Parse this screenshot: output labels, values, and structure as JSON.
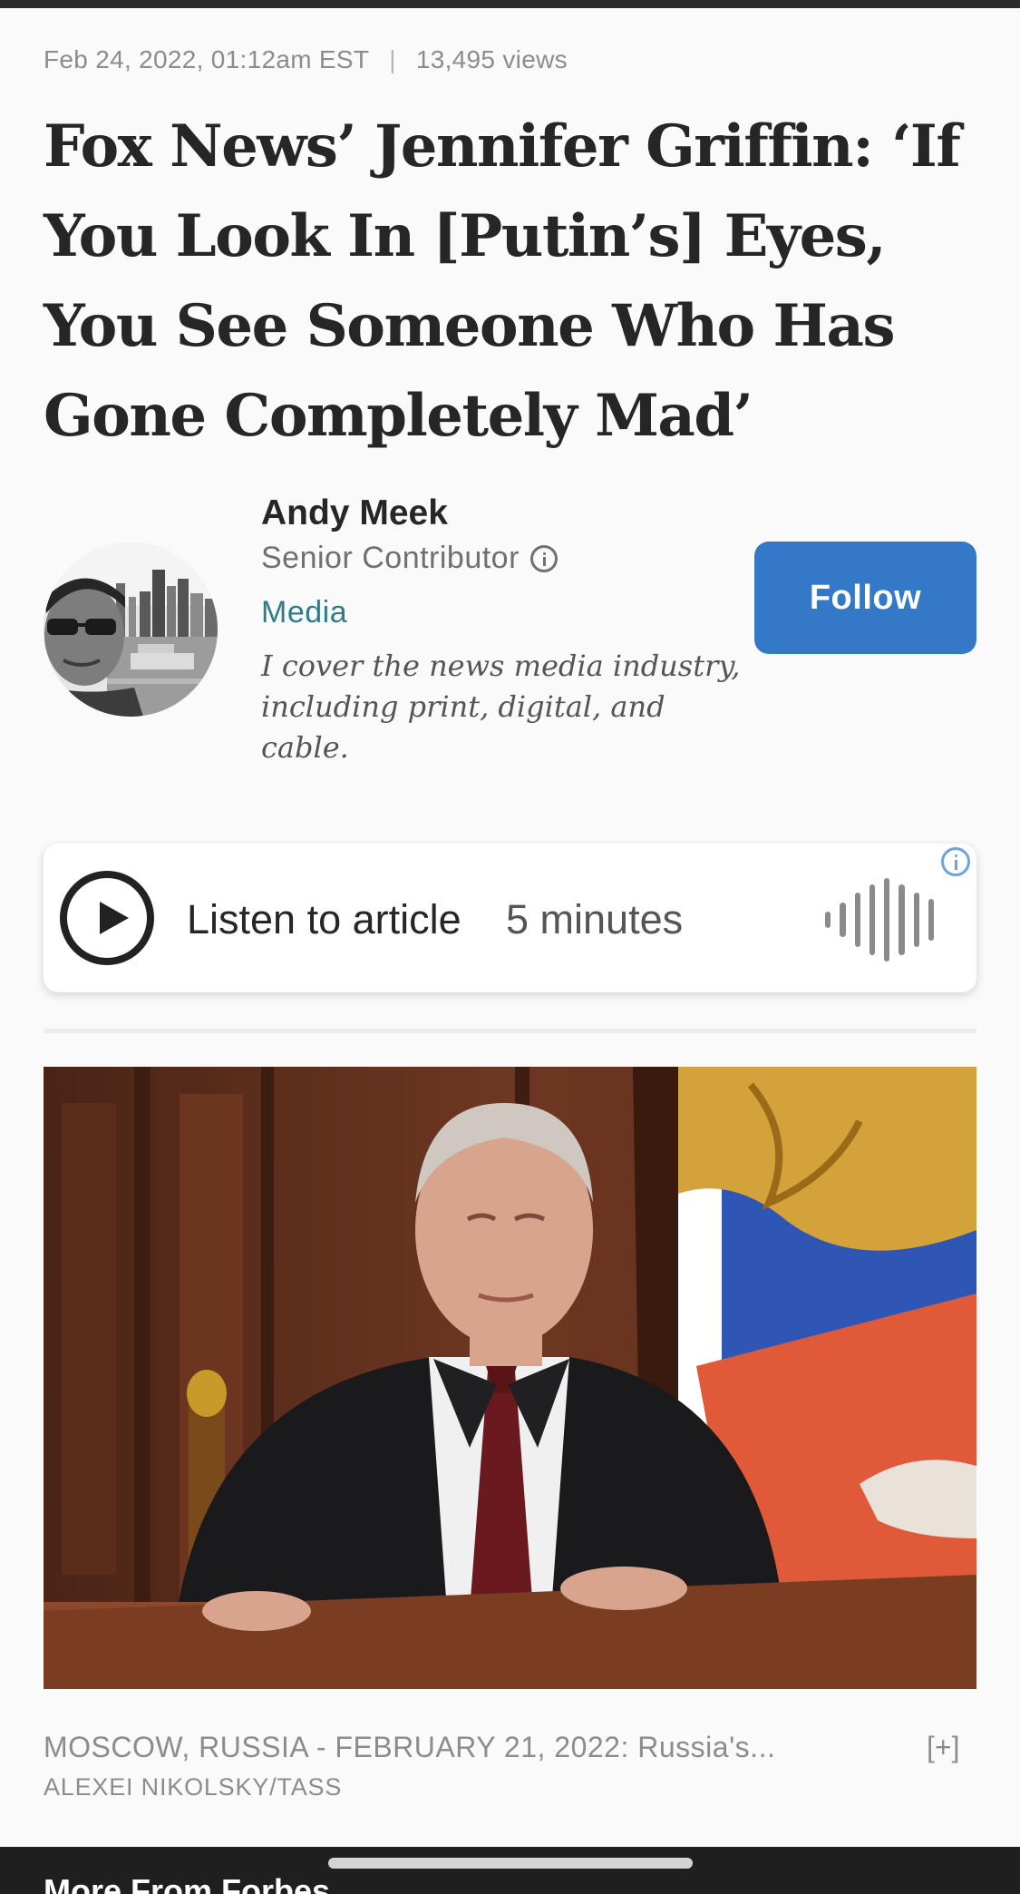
{
  "article": {
    "date": "Feb 24, 2022, 01:12am EST",
    "separator": "|",
    "views": "13,495 views",
    "headline": "Fox News’ Jennifer Griffin: ‘If You Look In [Putin’s] Eyes, You See Someone Who Has Gone Completely Mad’"
  },
  "author": {
    "name": "Andy Meek",
    "role": "Senior Contributor",
    "section": "Media",
    "bio": "I cover the news media industry, including print, digital, and cable.",
    "follow_label": "Follow",
    "follow_color": "#3379c7",
    "section_color": "#2e7d88"
  },
  "audio": {
    "label": "Listen to article",
    "duration": "5 minutes",
    "icons": [
      "play-icon",
      "waveform-icon",
      "info-icon"
    ]
  },
  "image": {
    "caption": "MOSCOW, RUSSIA - FEBRUARY 21, 2022: Russia's...",
    "expand_label": "[+]",
    "credit": "ALEXEI NIKOLSKY/TASS"
  },
  "footer": {
    "label": "More From Forbes"
  }
}
